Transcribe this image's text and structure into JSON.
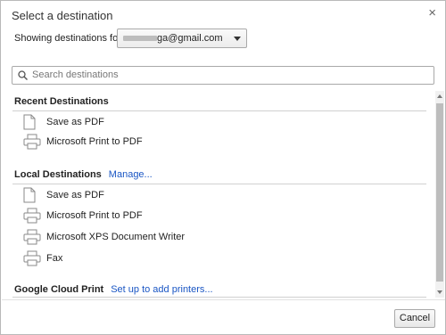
{
  "dialog": {
    "title": "Select a destination",
    "close_glyph": "×"
  },
  "account": {
    "label": "Showing destinations for",
    "selected_value": "ga@gmail.com"
  },
  "search": {
    "placeholder": "Search destinations",
    "value": ""
  },
  "recent": {
    "heading": "Recent Destinations",
    "items": [
      {
        "label": "Save as PDF",
        "icon": "document-icon"
      },
      {
        "label": "Microsoft Print to PDF",
        "icon": "printer-icon"
      }
    ]
  },
  "local": {
    "heading": "Local Destinations",
    "link": "Manage...",
    "items": [
      {
        "label": "Save as PDF",
        "icon": "document-icon"
      },
      {
        "label": "Microsoft Print to PDF",
        "icon": "printer-icon"
      },
      {
        "label": "Microsoft XPS Document Writer",
        "icon": "printer-icon"
      },
      {
        "label": "Fax",
        "icon": "printer-icon"
      }
    ]
  },
  "cloud": {
    "heading": "Google Cloud Print",
    "link": "Set up to add printers..."
  },
  "footer": {
    "cancel_label": "Cancel"
  },
  "colors": {
    "link": "#1a56c4",
    "divider": "#d0d0d0",
    "border": "#a9a9a9"
  }
}
